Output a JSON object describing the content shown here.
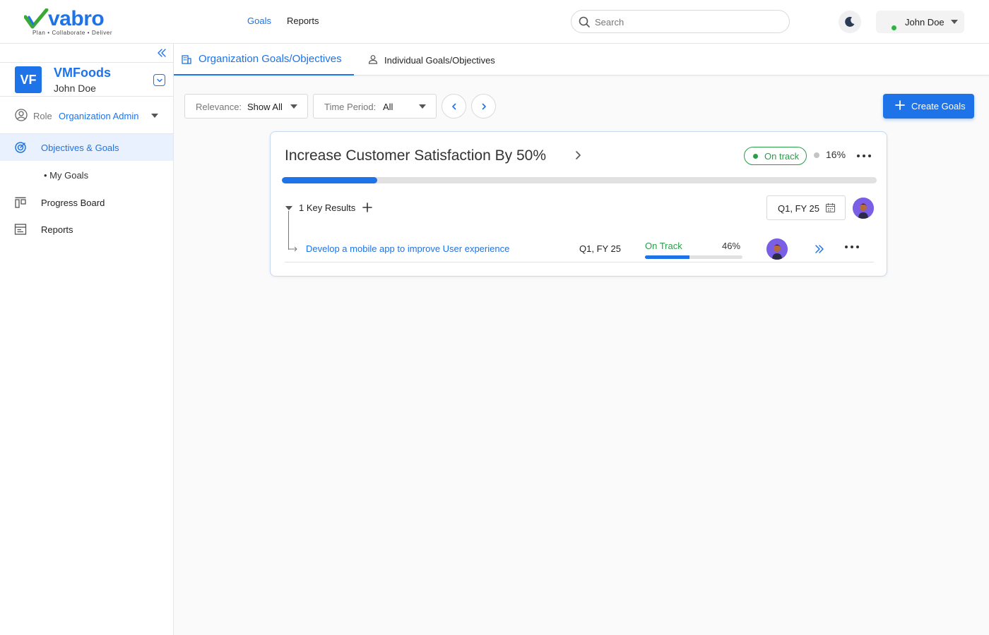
{
  "brand": {
    "name": "vabro",
    "tagline": "Plan • Collaborate • Deliver"
  },
  "topnav": {
    "items": [
      {
        "label": "Goals",
        "active": true
      },
      {
        "label": "Reports",
        "active": false
      }
    ]
  },
  "search": {
    "placeholder": "Search",
    "value": ""
  },
  "user": {
    "name": "John Doe",
    "status": "online"
  },
  "sidebar": {
    "org": {
      "initials": "VF",
      "name": "VMFoods",
      "user": "John Doe"
    },
    "role": {
      "label": "Role",
      "value": "Organization Admin"
    },
    "items": [
      {
        "label": "Objectives & Goals",
        "icon": "target-icon",
        "active": true
      },
      {
        "label": "My Goals",
        "sub": true
      },
      {
        "label": "Progress Board",
        "icon": "board-icon"
      },
      {
        "label": "Reports",
        "icon": "report-icon"
      }
    ]
  },
  "tabs": [
    {
      "label": "Organization Goals/Objectives",
      "icon": "building-icon",
      "active": true
    },
    {
      "label": "Individual Goals/Objectives",
      "icon": "person-icon",
      "active": false
    }
  ],
  "filters": {
    "relevance": {
      "label": "Relevance:",
      "value": "Show All"
    },
    "time_period": {
      "label": "Time Period:",
      "value": "All"
    }
  },
  "create_button": {
    "label": "Create Goals"
  },
  "goal": {
    "title": "Increase Customer Satisfaction By 50%",
    "status": "On track",
    "progress_pct": 16,
    "progress_label": "16%",
    "key_results_label": "1 Key Results",
    "period": "Q1, FY 25",
    "key_results": [
      {
        "title": "Develop a mobile app to improve User experience",
        "period": "Q1, FY 25",
        "status": "On Track",
        "progress_pct": 46,
        "progress_label": "46%"
      }
    ]
  },
  "colors": {
    "accent": "#1e73e8",
    "success": "#2a9d4a",
    "avatar_bg": "#7a5fe6"
  }
}
